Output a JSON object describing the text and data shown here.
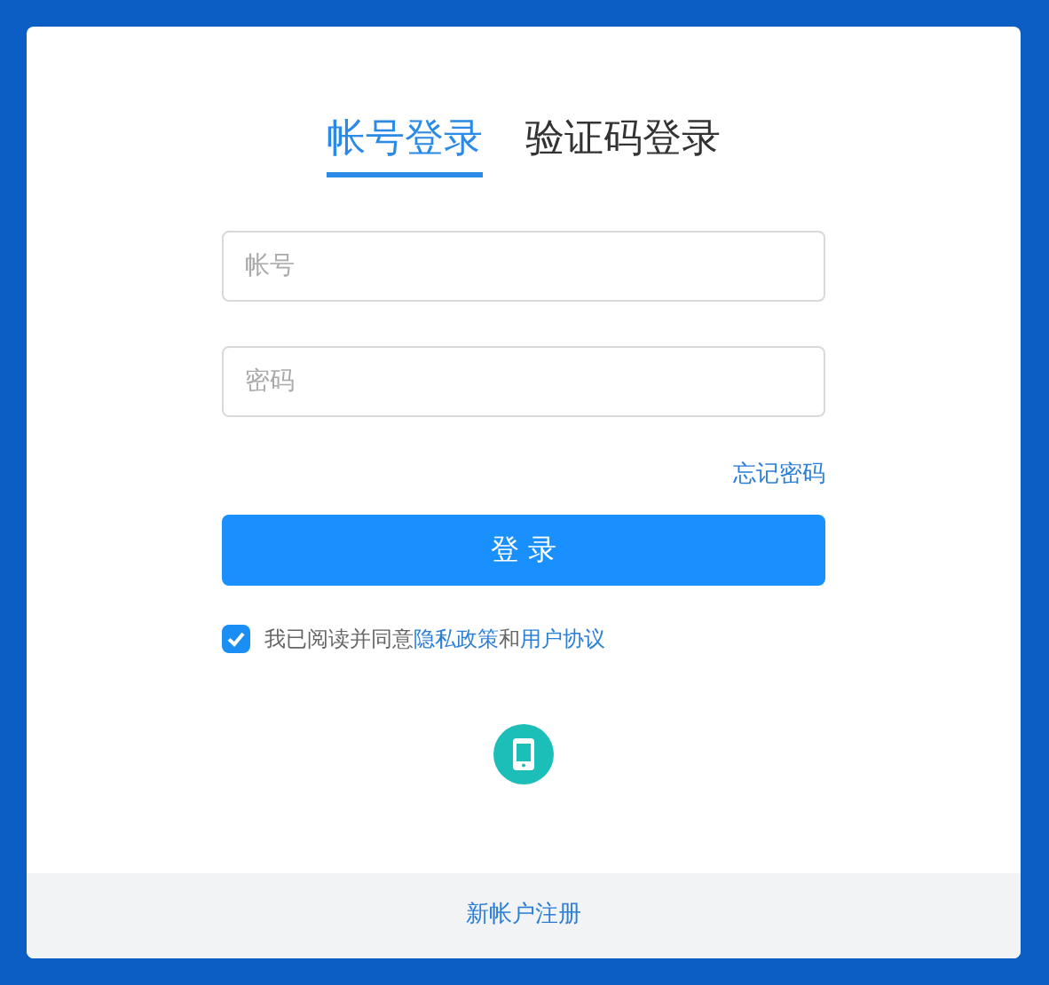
{
  "tabs": [
    {
      "label": "帐号登录",
      "selected": true
    },
    {
      "label": "验证码登录",
      "selected": false
    }
  ],
  "fields": [
    {
      "placeholder": "帐号"
    },
    {
      "placeholder": "密码"
    }
  ],
  "forgot_link": "忘记密码",
  "login_button": "登 录",
  "agreement": {
    "checked": true,
    "prefix": "我已阅读并同意",
    "privacy_link": "隐私政策",
    "joiner": "和",
    "terms_link": "用户协议"
  },
  "footer_link": "新帐户注册"
}
